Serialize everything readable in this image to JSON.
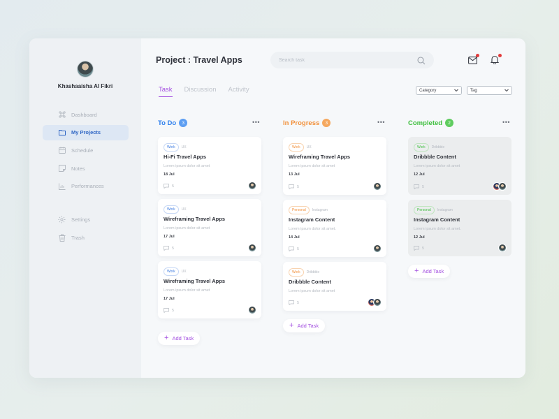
{
  "user": {
    "name": "Khashaaisha Al Fikri"
  },
  "nav": {
    "items": [
      {
        "label": "Dashboard",
        "icon": "command-icon"
      },
      {
        "label": "My Projects",
        "icon": "folder-icon",
        "active": true
      },
      {
        "label": "Schedule",
        "icon": "calendar-icon"
      },
      {
        "label": "Notes",
        "icon": "note-icon"
      },
      {
        "label": "Performances",
        "icon": "chart-icon"
      }
    ],
    "bottom": [
      {
        "label": "Settings",
        "icon": "gear-icon"
      },
      {
        "label": "Trash",
        "icon": "trash-icon"
      }
    ]
  },
  "header": {
    "title": "Project : Travel Apps",
    "search_placeholder": "Search task"
  },
  "tabs": [
    "Task",
    "Discussion",
    "Activity"
  ],
  "filters": {
    "category": "Category",
    "tag": "Tag"
  },
  "colors": {
    "todo": "#2f80ed",
    "inprogress": "#f2903a",
    "completed": "#3fbf3f",
    "accent": "#a34fe0",
    "work": "#3d7be0",
    "personal": "#3fbf3f"
  },
  "columns": [
    {
      "title": "To Do",
      "count": "3",
      "cards": [
        {
          "tag": "Work",
          "tag2": "UX",
          "title": "Hi-Fi Travel Apps",
          "desc": "Lorem ipsum dolor sit amet",
          "date": "18 Jul",
          "comments": "5"
        },
        {
          "tag": "Work",
          "tag2": "UX",
          "title": "Wireframing Travel Apps",
          "desc": "Lorem ipsum dolor sit amet",
          "date": "17 Jul",
          "comments": "5"
        },
        {
          "tag": "Work",
          "tag2": "UX",
          "title": "Wireframing Travel Apps",
          "desc": "Lorem ipsum dolor sit amet",
          "date": "17 Jul",
          "comments": "5"
        }
      ],
      "add_label": "Add Task"
    },
    {
      "title": "In Progress",
      "count": "3",
      "cards": [
        {
          "tag": "Work",
          "tag2": "UX",
          "title": "Wireframing Travel Apps",
          "desc": "Lorem ipsum dolor sit amet",
          "date": "13 Jul",
          "comments": "5"
        },
        {
          "tag": "Personal",
          "tag2": "Instagram",
          "title": "Instagram Content",
          "desc": "Lorem ipsum dolor sit amet.",
          "date": "14 Jul",
          "comments": "5"
        },
        {
          "tag": "Work",
          "tag2": "Dribbble",
          "title": "Dribbble Content",
          "desc": "Lorem ipsum dolor sit amet",
          "date": "",
          "comments": "5"
        }
      ],
      "add_label": "Add Task"
    },
    {
      "title": "Completed",
      "count": "2",
      "cards": [
        {
          "tag": "Work",
          "tag2": "Dribbble",
          "title": "Dribbble Content",
          "desc": "Lorem ipsum dolor sit amet",
          "date": "12 Jul",
          "comments": "5"
        },
        {
          "tag": "Personal",
          "tag2": "Instagram",
          "title": "Instagram Content",
          "desc": "Lorem ipsum dolor sit amet.",
          "date": "12 Jul",
          "comments": "5"
        }
      ],
      "add_label": "Add Task"
    }
  ]
}
